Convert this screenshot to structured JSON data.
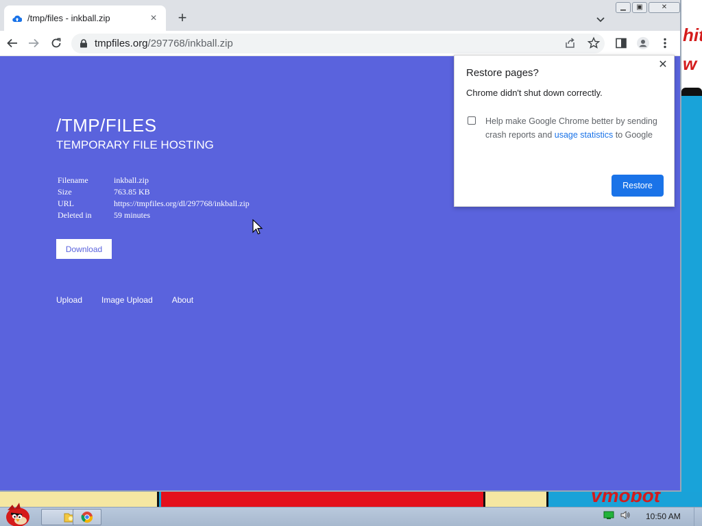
{
  "colors": {
    "page_bg": "#5a63dd",
    "accent": "#1a73e8",
    "tabstrip": "#dee1e6"
  },
  "desktop": {
    "wallpaper_text_right": "hit\nw",
    "wallpaper_text_bottom": "vmobot"
  },
  "browser": {
    "tab": {
      "title": "/tmp/files - inkball.zip",
      "favicon": "cloud-upload-icon"
    },
    "address": {
      "host": "tmpfiles.org",
      "path": "/297768/inkball.zip"
    }
  },
  "page": {
    "title": "/TMP/FILES",
    "subtitle": "TEMPORARY FILE HOSTING",
    "file_info": [
      {
        "key": "Filename",
        "value": "inkball.zip"
      },
      {
        "key": "Size",
        "value": "763.85 KB"
      },
      {
        "key": "URL",
        "value": "https://tmpfiles.org/dl/297768/inkball.zip"
      },
      {
        "key": "Deleted in",
        "value": "59 minutes"
      }
    ],
    "download_label": "Download",
    "footer_links": [
      "Upload",
      "Image Upload",
      "About"
    ]
  },
  "popup": {
    "title": "Restore pages?",
    "message": "Chrome didn't shut down correctly.",
    "help_text": "Help make Google Chrome better by sending crash reports and",
    "help_link": "usage statistics",
    "help_suffix": "to Google",
    "restore_label": "Restore"
  },
  "taskbar": {
    "clock": "10:50 AM"
  }
}
